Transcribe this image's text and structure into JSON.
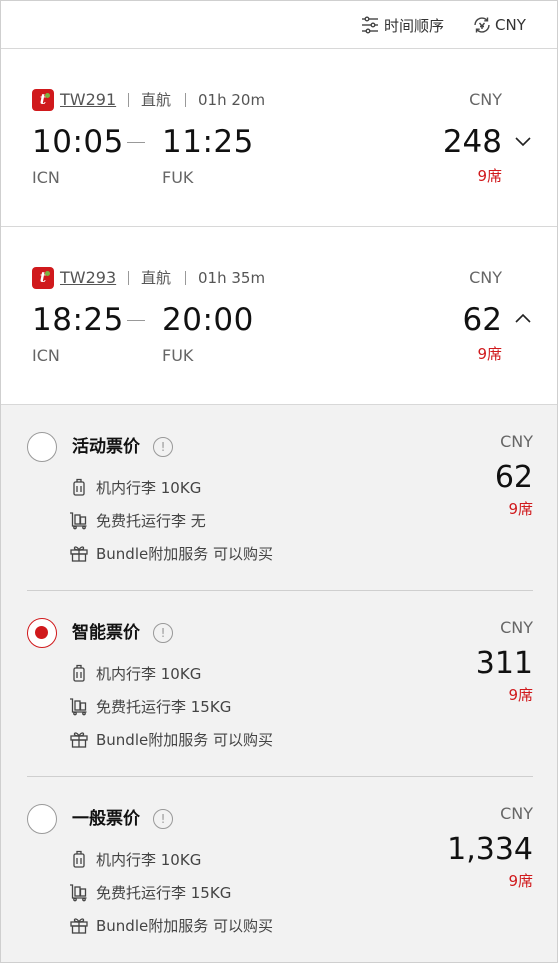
{
  "toolbar": {
    "sort_label": "时间顺序",
    "currency_label": "CNY",
    "accent": "#d0191c"
  },
  "flights": [
    {
      "airline_logo": "t",
      "flight_no": "TW291",
      "type": "直航",
      "duration": "01h 20m",
      "dep_time": "10:05",
      "arr_time": "11:25",
      "dep_airport": "ICN",
      "arr_airport": "FUK",
      "currency": "CNY",
      "price": "248",
      "seats": "9席",
      "expanded": false
    },
    {
      "airline_logo": "t",
      "flight_no": "TW293",
      "type": "直航",
      "duration": "01h 35m",
      "dep_time": "18:25",
      "arr_time": "20:00",
      "dep_airport": "ICN",
      "arr_airport": "FUK",
      "currency": "CNY",
      "price": "62",
      "seats": "9席",
      "expanded": true
    }
  ],
  "fares": [
    {
      "name": "活动票价",
      "selected": false,
      "currency": "CNY",
      "price": "62",
      "seats": "9席",
      "carry_on": "机内行李 10KG",
      "checked": "免费托运行李 无",
      "bundle": "Bundle附加服务 可以购买"
    },
    {
      "name": "智能票价",
      "selected": true,
      "currency": "CNY",
      "price": "311",
      "seats": "9席",
      "carry_on": "机内行李 10KG",
      "checked": "免费托运行李 15KG",
      "bundle": "Bundle附加服务 可以购买"
    },
    {
      "name": "一般票价",
      "selected": false,
      "currency": "CNY",
      "price": "1,334",
      "seats": "9席",
      "carry_on": "机内行李 10KG",
      "checked": "免费托运行李 15KG",
      "bundle": "Bundle附加服务 可以购买"
    }
  ],
  "icons": {
    "sort": "sliders-icon",
    "currency": "currency-exchange-icon",
    "info": "info-icon",
    "carry_on": "luggage-icon",
    "checked": "baggage-cart-icon",
    "bundle": "gift-icon"
  }
}
